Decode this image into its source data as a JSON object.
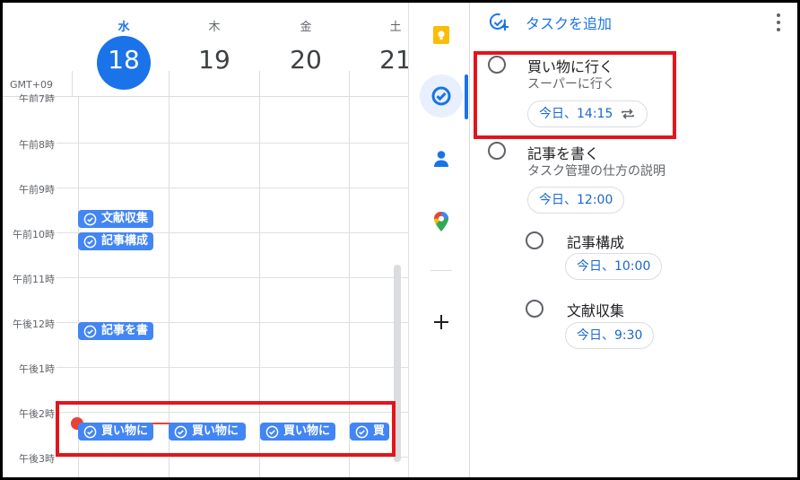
{
  "calendar": {
    "timezone": "GMT+09",
    "days": [
      {
        "dow": "水",
        "dom": "18",
        "today": true
      },
      {
        "dow": "木",
        "dom": "19"
      },
      {
        "dow": "金",
        "dom": "20"
      },
      {
        "dow": "土",
        "dom": "21"
      }
    ],
    "hours": [
      "午前7時",
      "午前8時",
      "午前9時",
      "午前10時",
      "午前11時",
      "午後12時",
      "午後1時",
      "午後2時",
      "午後3時"
    ],
    "events": [
      {
        "label": "文献収集"
      },
      {
        "label": "記事構成"
      },
      {
        "label": "記事を書"
      },
      {
        "label": "買い物に"
      },
      {
        "label": "買い物に"
      },
      {
        "label": "買い物に"
      },
      {
        "label": "買"
      }
    ]
  },
  "rail": {
    "items": [
      "keep-icon",
      "tasks-icon",
      "contacts-icon",
      "maps-icon",
      "add-icon"
    ],
    "colors": {
      "keep": "#fbbc04",
      "tasks": "#1a73e8",
      "contacts": "#1a73e8"
    }
  },
  "tasks": {
    "add_label": "タスクを追加",
    "items": [
      {
        "title": "買い物に行く",
        "desc": "スーパーに行く",
        "due": "今日、14:15",
        "repeat": true
      },
      {
        "title": "記事を書く",
        "desc": "タスク管理の仕方の説明",
        "due": "今日、12:00",
        "subtasks": [
          {
            "title": "記事構成",
            "due": "今日、10:00"
          },
          {
            "title": "文献収集",
            "due": "今日、9:30"
          }
        ]
      }
    ]
  },
  "colors": {
    "accent": "#1a73e8",
    "event": "#4285f4",
    "highlight": "#e3151c",
    "now": "#ea4335"
  }
}
